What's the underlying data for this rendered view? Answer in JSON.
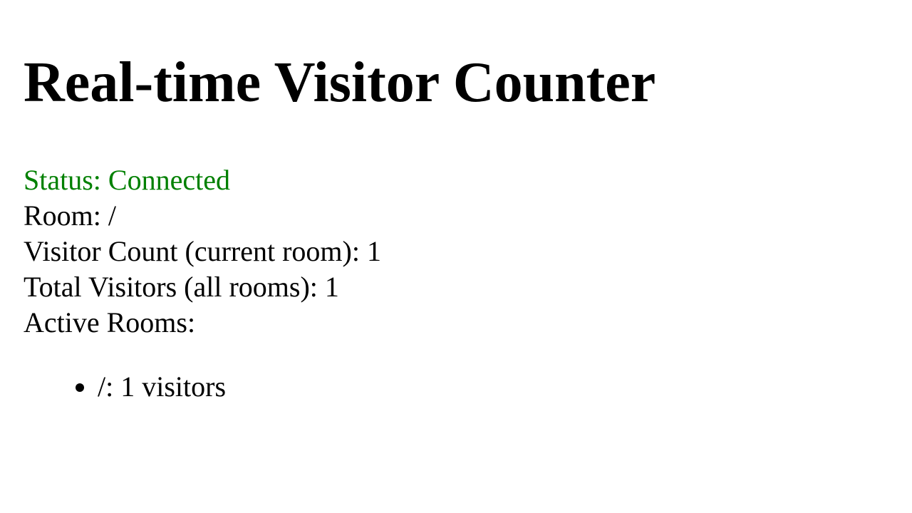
{
  "title": "Real-time Visitor Counter",
  "status": "Status: Connected",
  "status_color": "#008000",
  "room": "Room: /",
  "visitor_count": "Visitor Count (current room): 1",
  "total_visitors": "Total Visitors (all rooms): 1",
  "active_rooms_label": "Active Rooms:",
  "rooms": [
    {
      "text": "/: 1 visitors"
    }
  ]
}
